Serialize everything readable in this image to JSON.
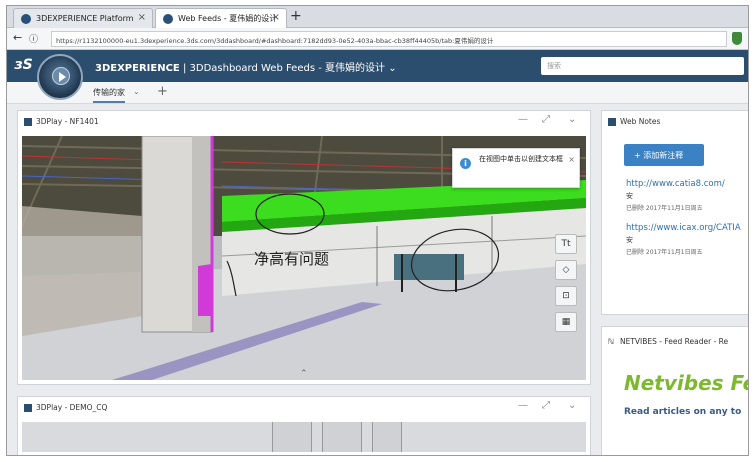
{
  "browser": {
    "tabs": [
      {
        "title": "3DEXPERIENCE Platform",
        "active": false
      },
      {
        "title": "Web Feeds - 夏伟娟的设计",
        "active": true
      }
    ],
    "new_tab_symbol": "+",
    "url": "https://r1132100000-eu1.3dexperience.3ds.com/3ddashboard/#dashboard:7182dd93-0e52-403a-bbac-cb38ff44405b/tab:夏伟娟的设计",
    "back_symbol": "←",
    "info_symbol": "ⓘ"
  },
  "app": {
    "brand": "3DEXPERIENCE",
    "separator": " | ",
    "app_name": "3DDashboard Web Feeds - 夏伟娟的设计",
    "caret": "⌄",
    "search_placeholder": "搜索",
    "ds_logo": "3S"
  },
  "dashboard": {
    "active_tab": "传输的家",
    "tab_caret": "⌄",
    "add_tab_symbol": "+"
  },
  "widgets": {
    "play1": {
      "title": "3DPlay - NF1401",
      "notice": "在视图中单击以创建文本框",
      "annotation": "净高有问题",
      "tools": [
        "Tt",
        "◇",
        "⊡",
        "▦"
      ]
    },
    "play2": {
      "title": "3DPlay - DEMO_CQ"
    },
    "web_notes": {
      "title": "Web Notes",
      "add_button": "+ 添加新注释",
      "notes": [
        {
          "url": "http://www.catia8.com/",
          "text": "安",
          "meta": "已删除 2017年11月1日周五"
        },
        {
          "url": "https://www.icax.org/CATIA",
          "text": "安",
          "meta": "已删除 2017年11月1日周五"
        }
      ]
    },
    "netvibes": {
      "title": "NETVIBES - Feed Reader - Re",
      "logo": "Netvibes Fe",
      "tagline": "Read articles on any to"
    }
  },
  "widget_controls": {
    "minimize": "—",
    "maximize": "⤢",
    "menu": "⌄"
  },
  "colors": {
    "appbar": "#2c4e6e",
    "accent_button": "#3b82c4",
    "netvibes_green": "#7eb830",
    "highlight_green": "#3cdc1e",
    "magenta": "#d23ad8"
  }
}
